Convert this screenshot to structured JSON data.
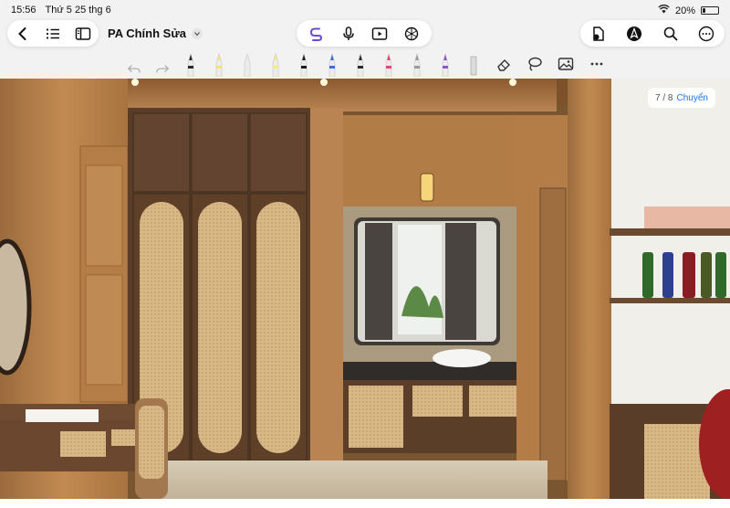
{
  "status": {
    "time": "15:56",
    "date": "Thứ 5 25 thg 6",
    "battery": "20%",
    "battery_level": 0.2
  },
  "toolbar": {
    "title": "PA Chính Sửa",
    "left_icons": [
      "back-icon",
      "list-icon",
      "sidebar-icon"
    ],
    "center_icons": [
      "link-icon",
      "microphone-icon",
      "play-icon",
      "ai-icon"
    ],
    "right_icons": [
      "add-page-icon",
      "pen-mode-icon",
      "search-icon",
      "more-icon"
    ]
  },
  "tools": {
    "items": [
      {
        "name": "undo-icon"
      },
      {
        "name": "redo-icon"
      },
      {
        "name": "fountain-pen",
        "color": "#2a2a2a"
      },
      {
        "name": "pencil-yellow",
        "color": "#f6e27a"
      },
      {
        "name": "pencil-white",
        "color": "#e8e8e8"
      },
      {
        "name": "highlighter-yellow",
        "color": "#f2ee7a"
      },
      {
        "name": "pen-black",
        "color": "#1a1a1a"
      },
      {
        "name": "pen-blue",
        "color": "#3b6fd8"
      },
      {
        "name": "brush-black",
        "color": "#2a2a2a"
      },
      {
        "name": "marker-pink",
        "color": "#e2486e"
      },
      {
        "name": "pencil-grey",
        "color": "#9a9a9a"
      },
      {
        "name": "marker-purple",
        "color": "#8e54c8"
      },
      {
        "name": "ruler",
        "color": "#dcdcdc"
      }
    ],
    "right": [
      "eraser-icon",
      "lasso-icon",
      "image-icon",
      "more-icon"
    ]
  },
  "page": {
    "current": "7 / 8",
    "switch_label": "Chuyển"
  },
  "colors": {
    "accent": "#1d72e8",
    "ai_purple": "#6d4ad8",
    "wood": "#b8834d",
    "wood_dark": "#6b4a2f",
    "wall": "#f1efe9"
  }
}
